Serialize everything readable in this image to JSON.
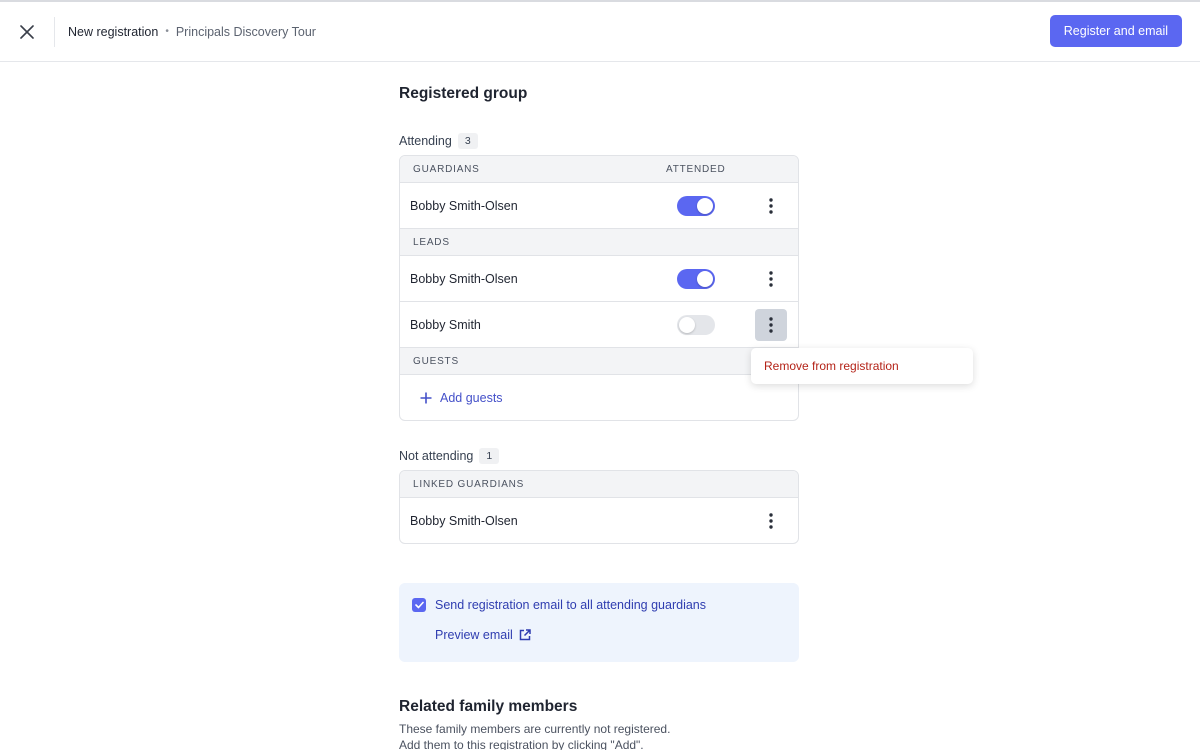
{
  "header": {
    "title": "New registration",
    "separator": "•",
    "subtitle": "Principals Discovery Tour",
    "primary_button": "Register and email"
  },
  "main": {
    "heading": "Registered group",
    "attending": {
      "label": "Attending",
      "count": "3",
      "attended_header": "ATTENDED",
      "groups": [
        {
          "header": "GUARDIANS",
          "rows": [
            {
              "name": "Bobby Smith-Olsen",
              "attended": true
            }
          ]
        },
        {
          "header": "LEADS",
          "rows": [
            {
              "name": "Bobby Smith-Olsen",
              "attended": true
            },
            {
              "name": "Bobby Smith",
              "attended": false
            }
          ]
        },
        {
          "header": "GUESTS",
          "add_label": "Add guests"
        }
      ]
    },
    "not_attending": {
      "label": "Not attending",
      "count": "1",
      "header": "LINKED GUARDIANS",
      "rows": [
        {
          "name": "Bobby Smith-Olsen"
        }
      ]
    },
    "context_menu": {
      "item": "Remove from registration",
      "color": "#b42318"
    },
    "email": {
      "checkbox_label": "Send registration email to all attending guardians",
      "checked": true,
      "preview_link": "Preview email"
    },
    "related": {
      "heading": "Related family members",
      "line1": "These family members are currently not registered.",
      "line2": "Add them to this registration by clicking \"Add\"."
    }
  },
  "colors": {
    "accent": "#5b67f1",
    "link": "#2f3db0",
    "danger": "#b42318"
  }
}
